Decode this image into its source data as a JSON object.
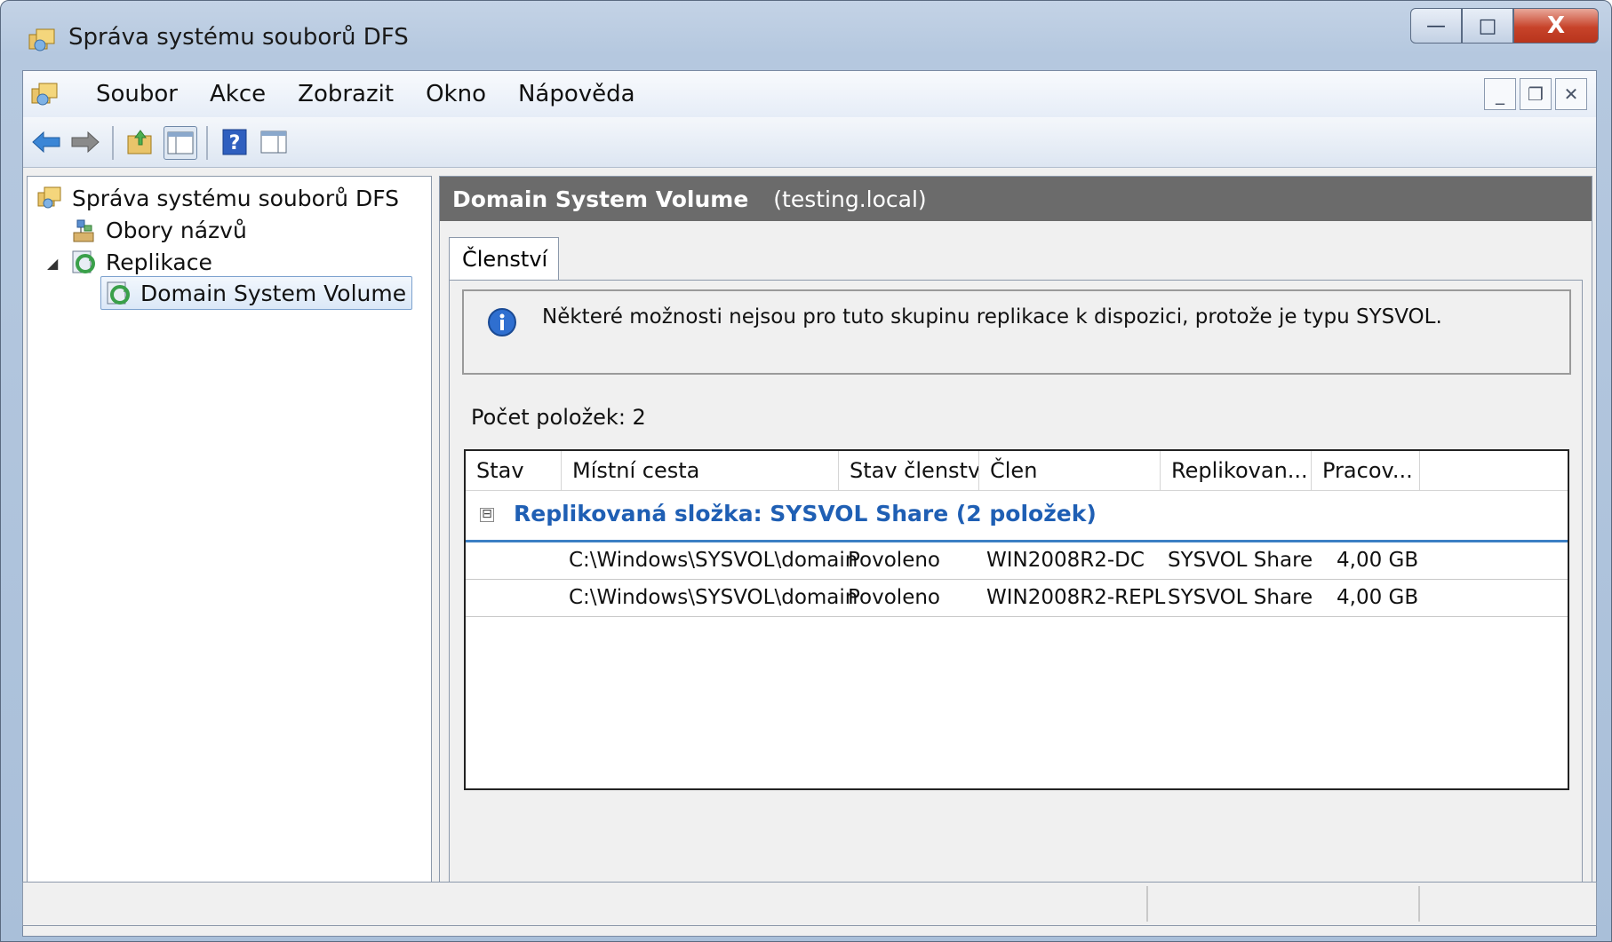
{
  "window": {
    "title": "Správa systému souborů DFS",
    "caption_buttons": {
      "minimize": "—",
      "maximize": "□",
      "close": "X"
    }
  },
  "menubar": {
    "items": [
      "Soubor",
      "Akce",
      "Zobrazit",
      "Okno",
      "Nápověda"
    ],
    "mdi_buttons": {
      "minimize": "_",
      "restore": "❐",
      "close": "✕"
    }
  },
  "toolbar": {
    "icons": [
      "back-arrow-icon",
      "forward-arrow-icon",
      "up-folder-icon",
      "show-hide-tree-icon",
      "help-icon",
      "action-pane-icon"
    ]
  },
  "tree": {
    "root": "Správa systému souborů DFS",
    "namespaces": "Obory názvů",
    "replication": "Replikace",
    "selected": "Domain System Volume",
    "expander": "◢"
  },
  "details": {
    "header_title": "Domain System Volume",
    "header_domain": "(testing.local)",
    "tab": "Členství",
    "info_message": "Některé možnosti nejsou pro tuto skupinu replikace k dispozici, protože je typu SYSVOL.",
    "item_count": "Počet položek: 2",
    "columns": [
      "Stav",
      "Místní cesta",
      "Stav členství",
      "Člen",
      "Replikovan...",
      "Pracov..."
    ],
    "group_toggle": "⊟",
    "group_title": "Replikovaná složka: SYSVOL Share (2 položek)",
    "rows": [
      {
        "path": "C:\\Windows\\SYSVOL\\domain",
        "membership": "Povoleno",
        "member": "WIN2008R2-DC",
        "replicated": "SYSVOL Share",
        "staging": "4,00 GB"
      },
      {
        "path": "C:\\Windows\\SYSVOL\\domain",
        "membership": "Povoleno",
        "member": "WIN2008R2-REPL",
        "replicated": "SYSVOL Share",
        "staging": "4,00 GB"
      }
    ]
  },
  "colors": {
    "header_bg": "#6b6b6b",
    "group_title": "#1f5fb4",
    "group_line": "#3c7fc4",
    "close_button": "#c7432a"
  }
}
